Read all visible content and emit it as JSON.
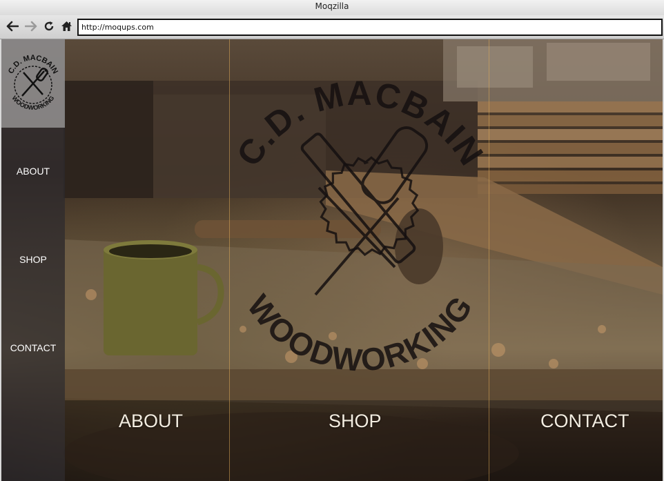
{
  "browser": {
    "window_title": "Moqzilla",
    "url": "http://moqups.com",
    "icons": [
      "back-arrow-icon",
      "forward-arrow-icon",
      "reload-icon",
      "home-icon"
    ]
  },
  "sidebar": {
    "logo_top_text": "C.D. MACBAIN",
    "logo_bottom_text": "WOODWORKING",
    "items": [
      {
        "label": "ABOUT"
      },
      {
        "label": "SHOP"
      },
      {
        "label": "CONTACT"
      }
    ]
  },
  "hero": {
    "logo_top_text": "C.D. MACBAIN",
    "logo_bottom_text": "WOODWORKING",
    "links": [
      {
        "label": "ABOUT"
      },
      {
        "label": "SHOP"
      },
      {
        "label": "CONTACT"
      }
    ]
  },
  "colors": {
    "sidebar_bg": "#2d2a2e",
    "divider": "#dcaa5a",
    "link_text": "#f2ece0"
  }
}
